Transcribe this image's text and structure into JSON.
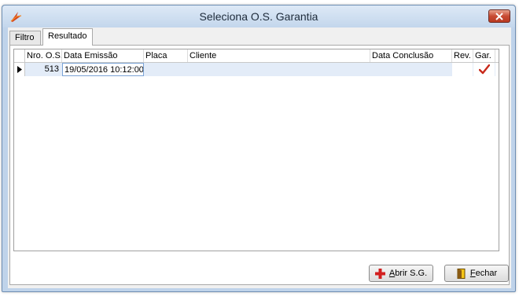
{
  "window": {
    "title": "Seleciona O.S. Garantia"
  },
  "tabs": [
    {
      "label": "Filtro",
      "active": false
    },
    {
      "label": "Resultado",
      "active": true
    }
  ],
  "grid": {
    "columns": [
      "Nro. O.S.",
      "Data Emissão",
      "Placa",
      "Cliente",
      "Data Conclusão",
      "Rev.",
      "Gar."
    ],
    "rows": [
      {
        "os": "513",
        "emissao": "19/05/2016 10:12:00",
        "placa": "",
        "cliente": "",
        "conclusao": "",
        "rev": "",
        "gar": "check-icon"
      }
    ]
  },
  "buttons": {
    "abrir": {
      "accel": "A",
      "rest": "brir S.G.",
      "icon": "red-cross-icon"
    },
    "fechar": {
      "accel": "F",
      "rest": "echar",
      "icon": "door-icon"
    }
  },
  "colors": {
    "accent": "#c8291a",
    "selection": "#e3ecf8"
  }
}
